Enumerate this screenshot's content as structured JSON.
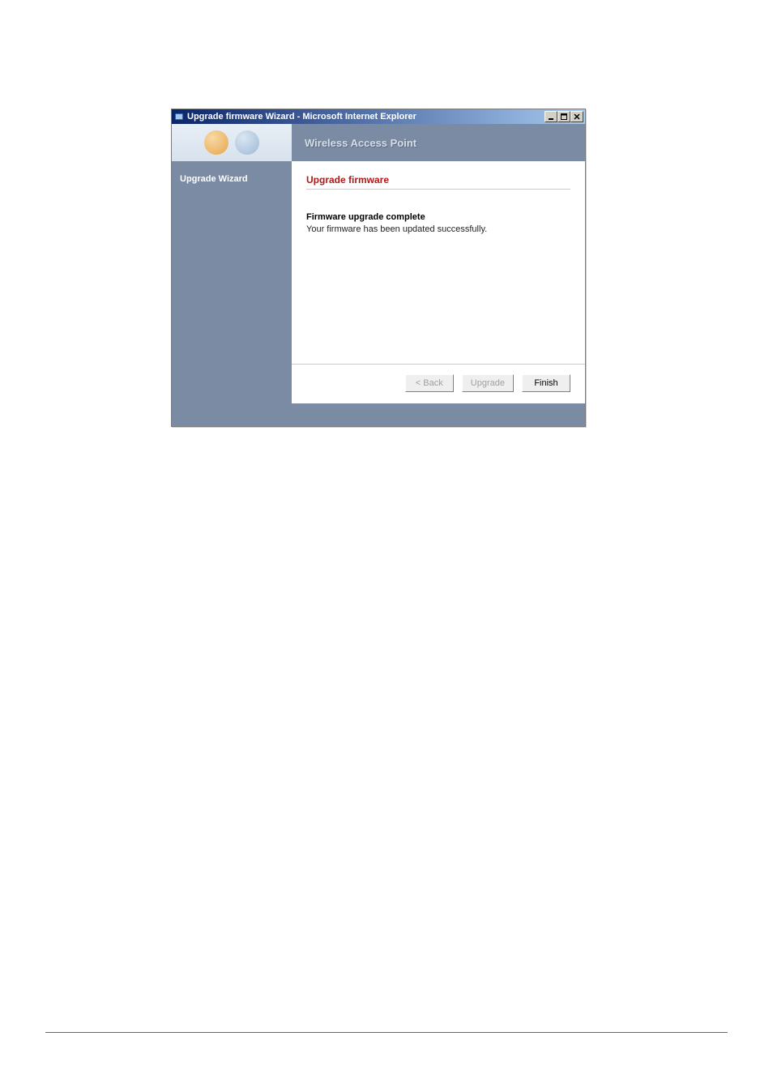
{
  "window": {
    "title": "Upgrade firmware Wizard - Microsoft Internet Explorer",
    "controls": {
      "minimize": "_",
      "maximize": "□",
      "close": "×"
    }
  },
  "sidebar": {
    "nav_item": "Upgrade Wizard"
  },
  "header": {
    "title": "Wireless Access Point"
  },
  "main": {
    "section_title": "Upgrade firmware",
    "status_heading": "Firmware upgrade complete",
    "status_text": "Your firmware has been updated successfully."
  },
  "buttons": {
    "back": "< Back",
    "upgrade": "Upgrade",
    "finish": "Finish"
  }
}
